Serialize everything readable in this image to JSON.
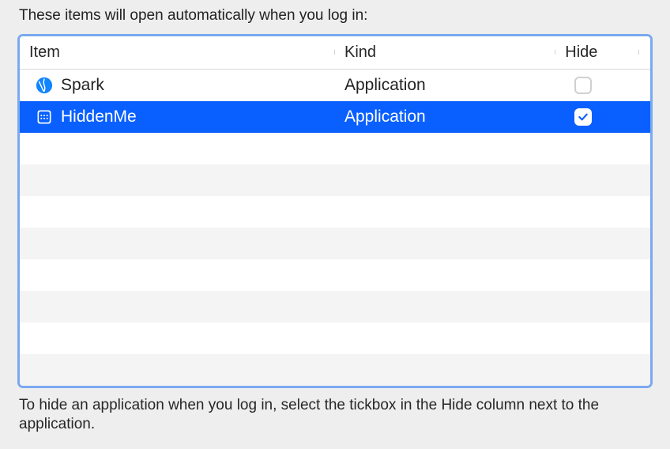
{
  "header_text": "These items will open automatically when you log in:",
  "footer_text": "To hide an application when you log in, select the tickbox in the Hide column next to the application.",
  "columns": {
    "item": "Item",
    "kind": "Kind",
    "hide": "Hide"
  },
  "items": [
    {
      "name": "Spark",
      "kind": "Application",
      "hide_checked": false,
      "selected": false,
      "icon": "spark-icon"
    },
    {
      "name": "HiddenMe",
      "kind": "Application",
      "hide_checked": true,
      "selected": true,
      "icon": "hiddenme-icon"
    }
  ],
  "total_rows_visible": 10,
  "selection_color": "#0a60ff",
  "frame_border_color": "#7aa9f0"
}
